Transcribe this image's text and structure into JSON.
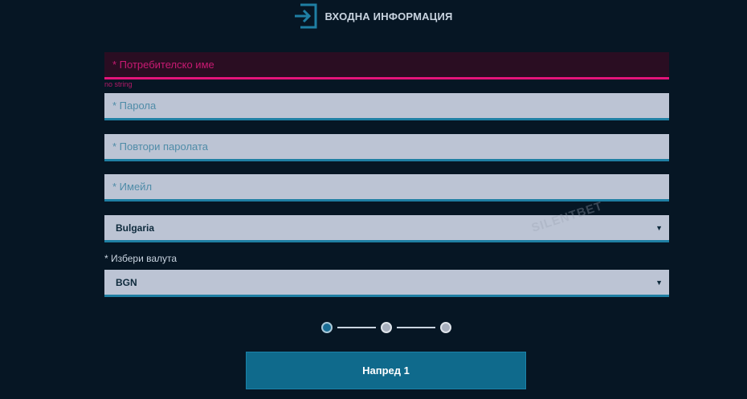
{
  "header": {
    "title": "ВХОДНА ИНФОРМАЦИЯ",
    "icon": "login-icon"
  },
  "form": {
    "username": {
      "placeholder": "* Потребителско име",
      "value": "",
      "error": "no string"
    },
    "password": {
      "placeholder": "* Парола",
      "value": ""
    },
    "repeat_password": {
      "placeholder": "* Повтори паролата",
      "value": ""
    },
    "email": {
      "placeholder": "* Имейл",
      "value": ""
    },
    "country": {
      "selected": "Bulgaria"
    },
    "currency": {
      "label": "* Избери валута",
      "selected": "BGN"
    }
  },
  "watermark": "SILENTBET",
  "stepper": {
    "current_step": 1,
    "total_steps": 3
  },
  "next_button": {
    "label": "Напред 1"
  },
  "colors": {
    "background": "#061624",
    "field": "#bcc4d4",
    "accent": "#1f7fa3",
    "error": "#e4147a",
    "button": "#0f6a8c"
  }
}
